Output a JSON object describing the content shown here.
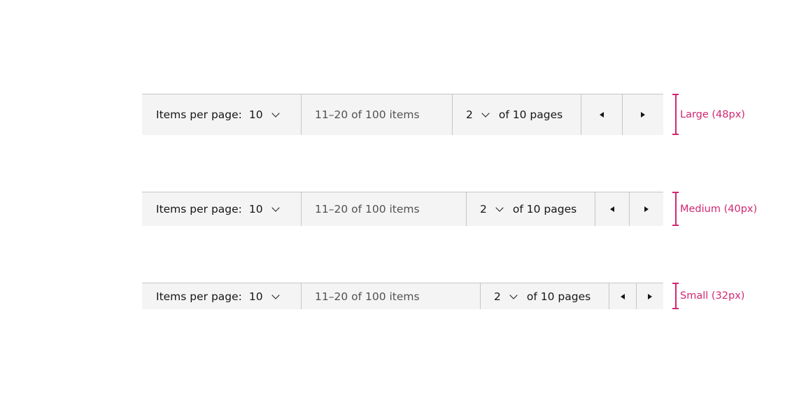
{
  "variants": [
    {
      "items_label": "Items per page:",
      "items_value": "10",
      "range": "11–20 of 100 items",
      "page_value": "2",
      "page_suffix": "of 10 pages",
      "size_label": "Large (48px)",
      "prev_icon": "caret-left-icon",
      "next_icon": "caret-right-icon"
    },
    {
      "items_label": "Items per page:",
      "items_value": "10",
      "range": "11–20 of 100 items",
      "page_value": "2",
      "page_suffix": "of 10 pages",
      "size_label": "Medium (40px)",
      "prev_icon": "caret-left-icon",
      "next_icon": "caret-right-icon"
    },
    {
      "items_label": "Items per page:",
      "items_value": "10",
      "range": "11–20 of 100 items",
      "page_value": "2",
      "page_suffix": "of 10 pages",
      "size_label": "Small (32px)",
      "prev_icon": "caret-left-icon",
      "next_icon": "caret-right-icon"
    }
  ],
  "colors": {
    "background": "#f4f4f4",
    "border": "#c6c6c6",
    "annotation": "#d12771",
    "text": "#161616",
    "secondary_text": "#525252"
  }
}
